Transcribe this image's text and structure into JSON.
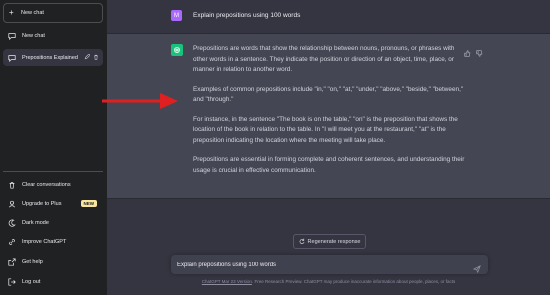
{
  "sidebar": {
    "new_chat_label": "New chat",
    "items": [
      {
        "label": "New chat",
        "icon": "chat-bubble-icon"
      },
      {
        "label": "Prepositions Explained",
        "icon": "chat-bubble-icon",
        "active": true
      }
    ],
    "bottom": [
      {
        "label": "Clear conversations",
        "icon": "trash-icon"
      },
      {
        "label": "Upgrade to Plus",
        "icon": "user-icon",
        "badge": "NEW"
      },
      {
        "label": "Dark mode",
        "icon": "moon-icon"
      },
      {
        "label": "Improve ChatGPT",
        "icon": "link-icon"
      },
      {
        "label": "Get help",
        "icon": "external-link-icon"
      },
      {
        "label": "Log out",
        "icon": "logout-icon"
      }
    ]
  },
  "conversation": {
    "user_avatar": "M",
    "user_message": "Explain prepositions using 100 words",
    "answer_paragraphs": [
      "Prepositions are words that show the relationship between nouns, pronouns, or phrases with other words in a sentence. They indicate the position or direction of an object, time, place, or manner in relation to another word.",
      "Examples of common prepositions include \"in,\" \"on,\" \"at,\" \"under,\" \"above,\" \"beside,\" \"between,\" and \"through.\"",
      "For instance, in the sentence \"The book is on the table,\" \"on\" is the preposition that shows the location of the book in relation to the table. In \"I will meet you at the restaurant,\" \"at\" is the preposition indicating the location where the meeting will take place.",
      "Prepositions are essential in forming complete and coherent sentences, and understanding their usage is crucial in effective communication."
    ]
  },
  "composer": {
    "regenerate_label": "Regenerate response",
    "input_value": "Explain prepositions using 100 words"
  },
  "footer": {
    "version_link": "ChatGPT Mar 23 Version",
    "disclaimer": ". Free Research Preview. ChatGPT may produce inaccurate information about people, places, or facts"
  },
  "colors": {
    "sidebar_bg": "#202123",
    "main_bg": "#343541",
    "assistant_bg": "#444654",
    "gpt_green": "#19c37d",
    "user_avatar": "#ab68ff",
    "arrow_red": "#e02020"
  }
}
